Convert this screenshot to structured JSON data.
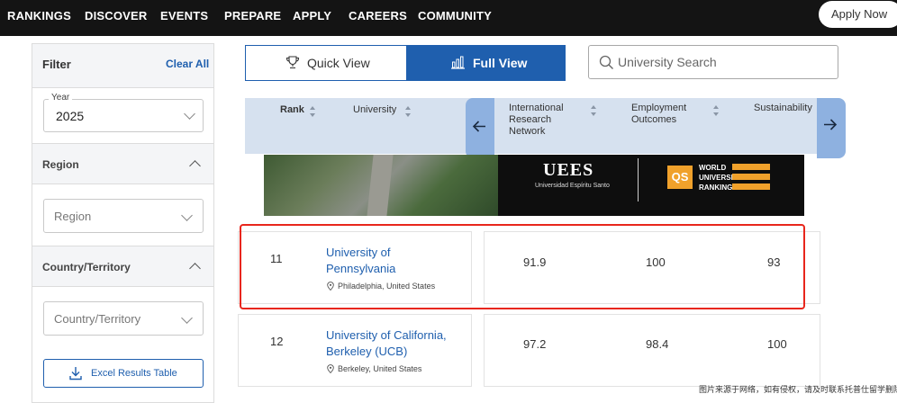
{
  "nav": {
    "items": [
      "RANKINGS",
      "DISCOVER",
      "EVENTS",
      "PREPARE",
      "APPLY",
      "CAREERS",
      "COMMUNITY"
    ],
    "apply_button": "Apply Now"
  },
  "filter": {
    "title": "Filter",
    "clear_all": "Clear All",
    "year_label": "Year",
    "year_value": "2025",
    "region_title": "Region",
    "region_placeholder": "Region",
    "country_title": "Country/Territory",
    "country_placeholder": "Country/Territory",
    "excel_button": "Excel Results Table"
  },
  "view": {
    "quick": "Quick View",
    "full": "Full View",
    "active": "full"
  },
  "search": {
    "placeholder": "University Search"
  },
  "table": {
    "col_rank": "Rank",
    "col_university": "University",
    "col_irn": "International Research Network",
    "col_employment": "Employment Outcomes",
    "col_sustainability": "Sustainability"
  },
  "banner": {
    "uees": "UEES",
    "uees_sub": "Universidad Espíritu Santo",
    "qs": "QS",
    "qs_line1": "WORLD",
    "qs_line2": "UNIVERSITY",
    "qs_line3": "RANKINGS"
  },
  "rows": [
    {
      "rank": "11",
      "name_line1": "University of",
      "name_line2": "Pennsylvania",
      "location": "Philadelphia, United States",
      "irn": "91.9",
      "employment": "100",
      "sustainability": "93"
    },
    {
      "rank": "12",
      "name_line1": "University of California,",
      "name_line2": "Berkeley (UCB)",
      "location": "Berkeley, United States",
      "irn": "97.2",
      "employment": "98.4",
      "sustainability": "100"
    }
  ],
  "watermark": "图片来源于网络，如有侵权，请及时联系托普仕留学删除",
  "colors": {
    "brand_blue": "#1f5fae",
    "header_bg": "#d6e1ef",
    "nav_bg": "#141414",
    "highlight": "#e8261c",
    "qs_orange": "#f0a12b"
  }
}
